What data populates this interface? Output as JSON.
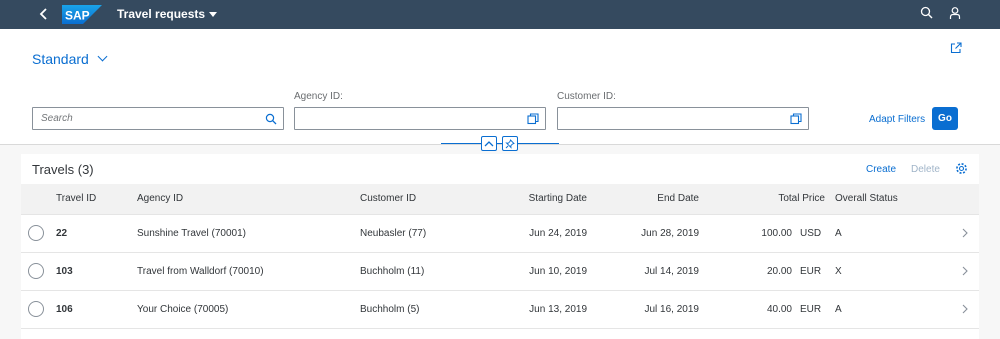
{
  "shell": {
    "logo_text": "SAP",
    "app_title": "Travel requests"
  },
  "header": {
    "variant": "Standard",
    "search": {
      "placeholder": "Search"
    },
    "agency": {
      "label": "Agency ID:",
      "value": ""
    },
    "customer": {
      "label": "Customer ID:",
      "value": ""
    },
    "adapt_filters": "Adapt Filters",
    "go": "Go"
  },
  "table": {
    "title": "Travels (3)",
    "create": "Create",
    "delete": "Delete",
    "columns": {
      "travel_id": "Travel ID",
      "agency_id": "Agency ID",
      "customer_id": "Customer ID",
      "starting_date": "Starting Date",
      "end_date": "End Date",
      "total_price": "Total Price",
      "overall_status": "Overall Status"
    },
    "rows": [
      {
        "travel_id": "22",
        "agency": "Sunshine Travel (70001)",
        "customer": "Neubasler (77)",
        "start": "Jun 24, 2019",
        "end": "Jun 28, 2019",
        "price": "100.00",
        "currency": "USD",
        "status": "A"
      },
      {
        "travel_id": "103",
        "agency": "Travel from Walldorf (70010)",
        "customer": "Buchholm (11)",
        "start": "Jun 10, 2019",
        "end": "Jul 14, 2019",
        "price": "20.00",
        "currency": "EUR",
        "status": "X"
      },
      {
        "travel_id": "106",
        "agency": "Your Choice (70005)",
        "customer": "Buchholm (5)",
        "start": "Jun 13, 2019",
        "end": "Jul 16, 2019",
        "price": "40.00",
        "currency": "EUR",
        "status": "A"
      }
    ]
  },
  "colors": {
    "shell": "#354a5f",
    "accent": "#0a6ed1",
    "disabled": "#a0b4c8"
  },
  "icons": [
    "back-icon",
    "sap-logo",
    "search-icon",
    "user-icon",
    "share-icon",
    "value-help-icon",
    "collapse-icon",
    "pin-icon",
    "settings-icon",
    "row-navigation-icon"
  ]
}
